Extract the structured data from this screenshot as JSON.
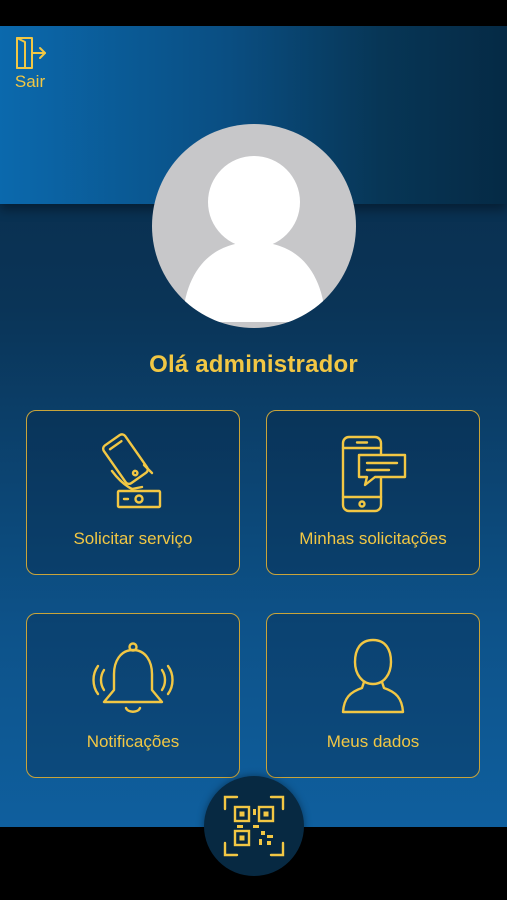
{
  "header": {
    "logout_label": "Sair",
    "logout_icon": "logout-door-icon"
  },
  "profile": {
    "avatar_icon": "user-avatar-icon",
    "greeting": "Olá administrador"
  },
  "tiles": [
    {
      "label": "Solicitar serviço",
      "icon": "hand-phone-icon"
    },
    {
      "label": "Minhas solicitações",
      "icon": "phone-message-icon"
    },
    {
      "label": "Notificações",
      "icon": "bell-icon"
    },
    {
      "label": "Meus dados",
      "icon": "person-icon"
    }
  ],
  "bottom": {
    "qr_icon": "qr-code-icon"
  },
  "colors": {
    "accent": "#f2c744",
    "tile_border": "#c9a43a",
    "background_dark": "#082a47",
    "background_light": "#0f5f9e"
  }
}
